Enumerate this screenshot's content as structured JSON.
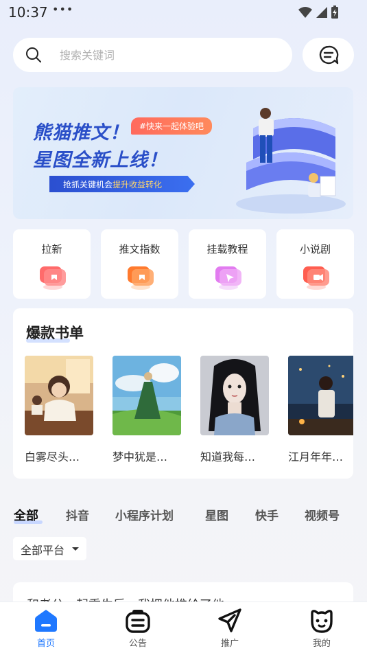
{
  "status_bar": {
    "time": "10:37",
    "dots": "•••"
  },
  "search": {
    "placeholder": "搜索关键词"
  },
  "banner": {
    "title_line1": "熊猫推文！",
    "title_line2": "星图全新上线！",
    "tag": "#快来一起体验吧",
    "strip_prefix": "抢抓关键机会",
    "strip_highlight": "提升收益转化"
  },
  "categories": [
    {
      "label": "拉新",
      "icon": "red-card-icon",
      "color": "#ff5b5b"
    },
    {
      "label": "推文指数",
      "icon": "orange-card-icon",
      "color": "#ff8a3d"
    },
    {
      "label": "挂载教程",
      "icon": "pink-card-icon",
      "color": "#e78bf2"
    },
    {
      "label": "小说剧",
      "icon": "video-card-icon",
      "color": "#ff6a5a"
    }
  ],
  "hot_books": {
    "title": "爆款书单",
    "items": [
      {
        "name": "白雾尽头…"
      },
      {
        "name": "梦中犹是…"
      },
      {
        "name": "知道我每…"
      },
      {
        "name": "江月年年…"
      }
    ]
  },
  "tabs": [
    "全部",
    "抖音",
    "小程序计划",
    "星图",
    "快手",
    "视频号"
  ],
  "platform_filter": {
    "selected": "全部平台"
  },
  "article_preview": {
    "text": "和老公一起重生后，我把他推给了他"
  },
  "bottom_nav": [
    {
      "label": "首页",
      "icon": "home-icon",
      "active": true
    },
    {
      "label": "公告",
      "icon": "notice-icon",
      "active": false
    },
    {
      "label": "推广",
      "icon": "send-icon",
      "active": false
    },
    {
      "label": "我的",
      "icon": "profile-icon",
      "active": false
    }
  ],
  "colors": {
    "accent": "#1f78ff",
    "brand_blue": "#2a4fc8"
  }
}
